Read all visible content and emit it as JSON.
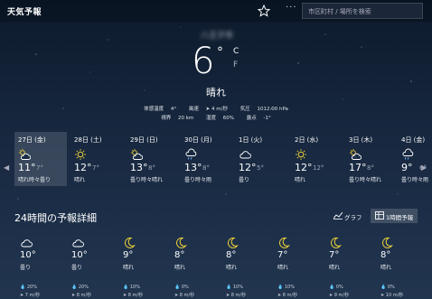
{
  "app": {
    "title": "天気予報"
  },
  "search": {
    "placeholder": "市区町村 / 場所を検索"
  },
  "current": {
    "location": "八王子市",
    "temp": "6",
    "deg": "°",
    "unit_c": "C",
    "unit_f": "F",
    "condition": "晴れ",
    "feels_label": "体感温度",
    "feels": "4°",
    "wind_label": "風速",
    "wind": "➤ 4 m/秒",
    "pressure_label": "気圧",
    "pressure": "1012.00 hPa",
    "visibility_label": "視界",
    "visibility": "20 km",
    "humidity_label": "湿度",
    "humidity": "60%",
    "dew_label": "露点",
    "dew": "-1°"
  },
  "days": [
    {
      "date": "27日 (金)",
      "hi": "11°",
      "lo": "7°",
      "cond": "晴れ時々曇り",
      "icon": "partly-cloudy"
    },
    {
      "date": "28日 (土)",
      "hi": "12°",
      "lo": "7°",
      "cond": "晴れ",
      "icon": "sun"
    },
    {
      "date": "29日 (日)",
      "hi": "13°",
      "lo": "8°",
      "cond": "曇り時々晴れ",
      "icon": "partly-cloudy"
    },
    {
      "date": "30日 (月)",
      "hi": "13°",
      "lo": "8°",
      "cond": "曇り時々雨",
      "icon": "cloud-rain"
    },
    {
      "date": "1日 (火)",
      "hi": "12°",
      "lo": "5°",
      "cond": "曇り",
      "icon": "cloud"
    },
    {
      "date": "2日 (水)",
      "hi": "12°",
      "lo": "12°",
      "cond": "晴れ",
      "icon": "sun"
    },
    {
      "date": "3日 (木)",
      "hi": "17°",
      "lo": "8°",
      "cond": "曇り時々晴れ",
      "icon": "partly-cloudy"
    },
    {
      "date": "4日 (金)",
      "hi": "9°",
      "lo": "6°",
      "cond": "曇り時々雨",
      "icon": "cloud-rain"
    }
  ],
  "hourly_section": {
    "title": "24時間の予報詳細",
    "graph_label": "グラフ",
    "hourly_label": "1時間予報"
  },
  "hours": [
    {
      "temp": "10°",
      "cond": "曇り",
      "icon": "cloud",
      "precip": "20%",
      "wind": "7 m/秒"
    },
    {
      "temp": "10°",
      "cond": "曇り",
      "icon": "cloud",
      "precip": "20%",
      "wind": "8 m/秒"
    },
    {
      "temp": "9°",
      "cond": "晴れ",
      "icon": "moon",
      "precip": "10%",
      "wind": "8 m/秒"
    },
    {
      "temp": "8°",
      "cond": "晴れ",
      "icon": "moon",
      "precip": "0%",
      "wind": "8 m/秒"
    },
    {
      "temp": "8°",
      "cond": "晴れ",
      "icon": "moon",
      "precip": "10%",
      "wind": "8 m/秒"
    },
    {
      "temp": "7°",
      "cond": "晴れ",
      "icon": "moon",
      "precip": "10%",
      "wind": "8 m/秒"
    },
    {
      "temp": "7°",
      "cond": "晴れ",
      "icon": "moon",
      "precip": "0%",
      "wind": "9 m/秒"
    },
    {
      "temp": "8°",
      "cond": "晴れ",
      "icon": "moon",
      "precip": "0%",
      "wind": "10 m/秒"
    }
  ],
  "colors": {
    "moon": "#f2d43a",
    "sun": "#f2d43a",
    "cloud": "#ffffff"
  }
}
